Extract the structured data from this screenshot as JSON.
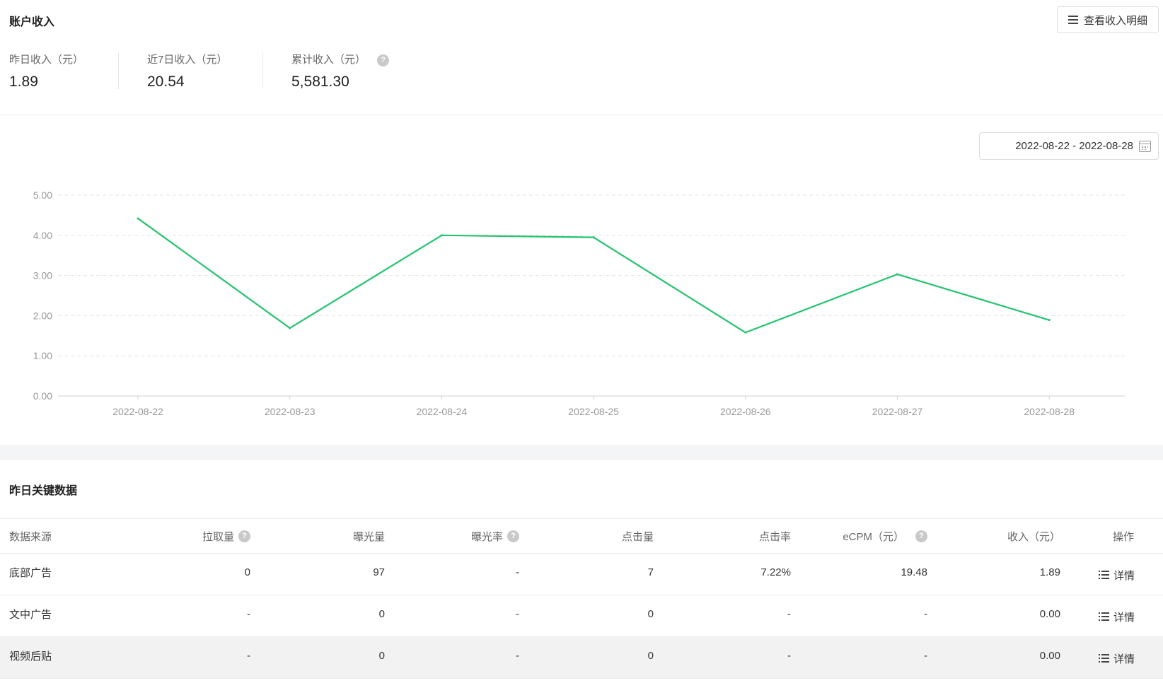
{
  "account": {
    "title": "账户收入",
    "detail_button": "查看收入明细",
    "stats": [
      {
        "label": "昨日收入（元）",
        "value": "1.89"
      },
      {
        "label": "近7日收入（元）",
        "value": "20.54"
      },
      {
        "label": "累计收入（元）",
        "value": "5,581.30"
      }
    ]
  },
  "date_range": "2022-08-22 - 2022-08-28",
  "chart_data": {
    "type": "line",
    "x": [
      "2022-08-22",
      "2022-08-23",
      "2022-08-24",
      "2022-08-25",
      "2022-08-26",
      "2022-08-27",
      "2022-08-28"
    ],
    "series": [
      {
        "values": [
          4.42,
          1.69,
          4.0,
          3.95,
          1.58,
          3.03,
          1.89
        ],
        "color": "#23c46e"
      }
    ],
    "yticks": [
      "0.00",
      "1.00",
      "2.00",
      "3.00",
      "4.00",
      "5.00"
    ],
    "ylim": [
      0,
      5
    ],
    "grid": true,
    "title": "",
    "xlabel": "",
    "ylabel": ""
  },
  "key_data": {
    "title": "昨日关键数据",
    "headers": [
      "数据来源",
      "拉取量",
      "曝光量",
      "曝光率",
      "点击量",
      "点击率",
      "eCPM（元）",
      "收入（元）",
      "操作"
    ],
    "detail_label": "详情",
    "rows": [
      [
        "底部广告",
        "0",
        "97",
        "-",
        "7",
        "7.22%",
        "19.48",
        "1.89"
      ],
      [
        "文中广告",
        "-",
        "0",
        "-",
        "0",
        "-",
        "-",
        "0.00"
      ],
      [
        "视频后贴",
        "-",
        "0",
        "-",
        "0",
        "-",
        "-",
        "0.00"
      ]
    ]
  },
  "colors": {
    "line": "#23c46e",
    "grid": "#e3e3e3",
    "axis_text": "#999999"
  }
}
